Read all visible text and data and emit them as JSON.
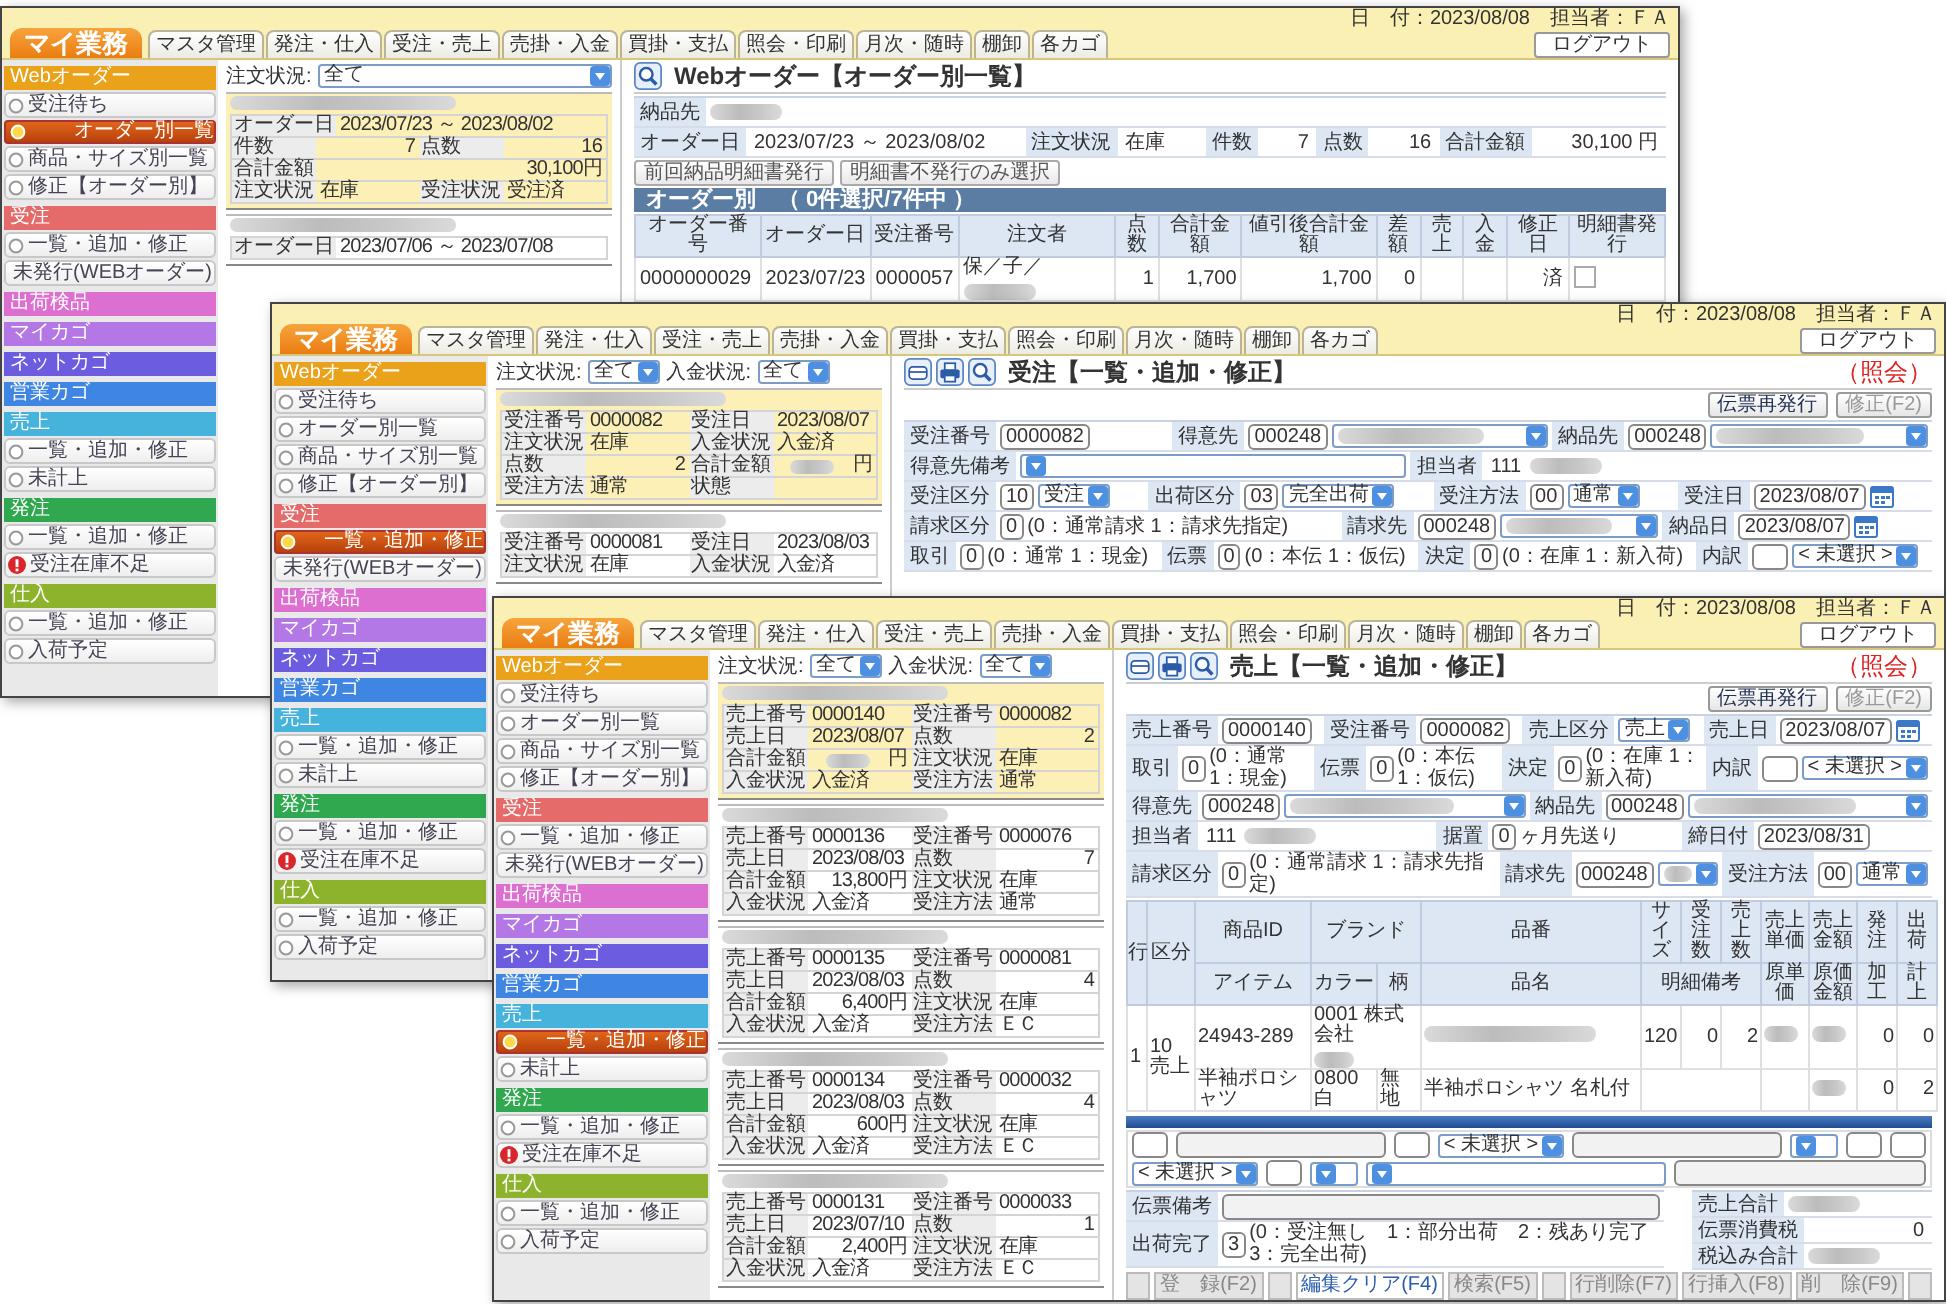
{
  "windows": [
    {
      "kind": "list_view",
      "header": {
        "brand": "マイ業務",
        "tabs": [
          "マスタ管理",
          "発注・仕入",
          "受注・売上",
          "売掛・入金",
          "買掛・支払",
          "照会・印刷",
          "月次・随時",
          "棚卸",
          "各カゴ"
        ],
        "date": "日　付：2023/08/08",
        "user": "担当者：ＦＡ",
        "logout": "ログアウト"
      },
      "sidebar": [
        {
          "title": "Webオーダー",
          "color": "#e9a21a",
          "items": [
            {
              "label": "受注待ち",
              "selected": false,
              "alert": false
            },
            {
              "label": "オーダー別一覧",
              "selected": true,
              "alert": false
            },
            {
              "label": "商品・サイズ別一覧",
              "selected": false,
              "alert": false
            },
            {
              "label": "修正【オーダー別】",
              "selected": false,
              "alert": false
            }
          ]
        },
        {
          "title": "受注",
          "color": "#e56b6b",
          "items": [
            {
              "label": "一覧・追加・修正",
              "selected": false,
              "alert": false
            },
            {
              "label": "未発行(WEBオーダー)",
              "selected": false,
              "alert": false
            }
          ]
        },
        {
          "title": "出荷検品",
          "color": "#dc6fcf"
        },
        {
          "title": "マイカゴ",
          "color": "#b478e6"
        },
        {
          "title": "ネットカゴ",
          "color": "#6b5ce0"
        },
        {
          "title": "営業カゴ",
          "color": "#3f86e3"
        },
        {
          "title": "売上",
          "color": "#46b3dc",
          "items": [
            {
              "label": "一覧・追加・修正",
              "selected": false,
              "alert": false
            },
            {
              "label": "未計上",
              "selected": false,
              "alert": false
            }
          ]
        },
        {
          "title": "発注",
          "color": "#2fa84f",
          "items": [
            {
              "label": "一覧・追加・修正",
              "selected": false,
              "alert": false
            },
            {
              "label": "受注在庫不足",
              "selected": false,
              "alert": true
            }
          ]
        },
        {
          "title": "仕入",
          "color": "#8db32c",
          "items": [
            {
              "label": "一覧・追加・修正",
              "selected": false,
              "alert": false
            },
            {
              "label": "入荷予定",
              "selected": false,
              "alert": false
            }
          ]
        }
      ],
      "filters": [
        {
          "label": "注文状況:",
          "value": "全て"
        }
      ],
      "cards": [
        {
          "selected": true,
          "rows": [
            [
              {
                "label": "オーダー日",
                "kind": "text",
                "value": "2023/07/23 ～ 2023/08/02"
              }
            ],
            [
              {
                "label": "件数",
                "kind": "num",
                "value": "7"
              },
              {
                "label": "点数",
                "kind": "num",
                "value": "16"
              }
            ],
            [
              {
                "label": "合計金額",
                "kind": "num",
                "value": "30,100円"
              }
            ],
            [
              {
                "label": "注文状況",
                "kind": "text",
                "value": "在庫"
              },
              {
                "label": "受注状況",
                "kind": "text",
                "value": "受注済"
              }
            ]
          ]
        },
        {
          "selected": false,
          "rows": [
            [
              {
                "label": "オーダー日",
                "kind": "text",
                "value": "2023/07/06 ～ 2023/07/08"
              }
            ]
          ]
        }
      ],
      "main": {
        "title": "Webオーダー【オーダー別一覧】",
        "form_rows": [
          [
            {
              "label": "納品先",
              "controls": [
                {
                  "kind": "blur"
                }
              ]
            }
          ],
          [
            {
              "label": "オーダー日",
              "controls": [
                {
                  "kind": "text",
                  "value": "2023/07/23 ～ 2023/08/02"
                }
              ]
            },
            {
              "label": "注文状況",
              "controls": [
                {
                  "kind": "text",
                  "value": "在庫"
                }
              ]
            },
            {
              "label": "件数",
              "controls": [
                {
                  "kind": "num",
                  "value": "7"
                }
              ]
            },
            {
              "label": "点数",
              "controls": [
                {
                  "kind": "num",
                  "value": "16"
                }
              ]
            },
            {
              "label": "合計金額",
              "controls": [
                {
                  "kind": "num",
                  "value": "30,100 円"
                }
              ]
            }
          ]
        ],
        "buttons": [
          "前回納品明細書発行",
          "明細書不発行のみ選択"
        ],
        "table": {
          "caption": "オーダー別　（ 0件選択/7件中 ）",
          "columns": [
            "オーダー番号",
            "オーダー日",
            "受注番号",
            "注文者",
            "点数",
            "合計金額",
            "値引後合計金額",
            "差額",
            "売上",
            "入金",
            "修正日",
            "明細書発行"
          ],
          "rows": [
            {
              "checked": false,
              "cells": [
                {
                  "kind": "text",
                  "text": "0000000029"
                },
                {
                  "kind": "text",
                  "text": "2023/07/23"
                },
                {
                  "kind": "text",
                  "text": "0000057"
                },
                {
                  "kind": "textblur",
                  "text": "保／子／"
                },
                {
                  "kind": "num",
                  "text": "1"
                },
                {
                  "kind": "num",
                  "text": "1,700"
                },
                {
                  "kind": "num",
                  "text": "1,700"
                },
                {
                  "kind": "num",
                  "text": "0"
                },
                {
                  "kind": "empty"
                },
                {
                  "kind": "empty"
                },
                {
                  "kind": "num",
                  "text": "済"
                }
              ]
            }
          ]
        }
      }
    },
    {
      "kind": "entry_form",
      "header": {
        "brand": "マイ業務",
        "tabs": [
          "マスタ管理",
          "発注・仕入",
          "受注・売上",
          "売掛・入金",
          "買掛・支払",
          "照会・印刷",
          "月次・随時",
          "棚卸",
          "各カゴ"
        ],
        "date": "日　付：2023/08/08",
        "user": "担当者：ＦＡ",
        "logout": "ログアウト"
      },
      "sidebar": [
        {
          "title": "Webオーダー",
          "color": "#e9a21a",
          "items": [
            {
              "label": "受注待ち",
              "selected": false,
              "alert": false
            },
            {
              "label": "オーダー別一覧",
              "selected": false,
              "alert": false
            },
            {
              "label": "商品・サイズ別一覧",
              "selected": false,
              "alert": false
            },
            {
              "label": "修正【オーダー別】",
              "selected": false,
              "alert": false
            }
          ]
        },
        {
          "title": "受注",
          "color": "#e56b6b",
          "items": [
            {
              "label": "一覧・追加・修正",
              "selected": true,
              "alert": false
            },
            {
              "label": "未発行(WEBオーダー)",
              "selected": false,
              "alert": false
            }
          ]
        },
        {
          "title": "出荷検品",
          "color": "#dc6fcf"
        },
        {
          "title": "マイカゴ",
          "color": "#b478e6"
        },
        {
          "title": "ネットカゴ",
          "color": "#6b5ce0"
        },
        {
          "title": "営業カゴ",
          "color": "#3f86e3"
        },
        {
          "title": "売上",
          "color": "#46b3dc",
          "items": [
            {
              "label": "一覧・追加・修正",
              "selected": false,
              "alert": false
            },
            {
              "label": "未計上",
              "selected": false,
              "alert": false
            }
          ]
        },
        {
          "title": "発注",
          "color": "#2fa84f",
          "items": [
            {
              "label": "一覧・追加・修正",
              "selected": false,
              "alert": false
            },
            {
              "label": "受注在庫不足",
              "selected": false,
              "alert": true
            }
          ]
        },
        {
          "title": "仕入",
          "color": "#8db32c",
          "items": [
            {
              "label": "一覧・追加・修正",
              "selected": false,
              "alert": false
            },
            {
              "label": "入荷予定",
              "selected": false,
              "alert": false
            }
          ]
        }
      ],
      "filters": [
        {
          "label": "注文状況:",
          "value": "全て"
        },
        {
          "label": "入金状況:",
          "value": "全て"
        }
      ],
      "cards": [
        {
          "selected": true,
          "rows": [
            [
              {
                "label": "受注番号",
                "kind": "text",
                "value": "0000082"
              },
              {
                "label": "受注日",
                "kind": "text",
                "value": "2023/08/07"
              }
            ],
            [
              {
                "label": "注文状況",
                "kind": "text",
                "value": "在庫"
              },
              {
                "label": "入金状況",
                "kind": "text",
                "value": "入金済"
              }
            ],
            [
              {
                "label": "点数",
                "kind": "num",
                "value": "2"
              },
              {
                "label": "合計金額",
                "kind": "blurnum",
                "value": "円"
              }
            ],
            [
              {
                "label": "受注方法",
                "kind": "text",
                "value": "通常"
              },
              {
                "label": "状態",
                "kind": "empty"
              }
            ]
          ]
        },
        {
          "selected": false,
          "rows": [
            [
              {
                "label": "受注番号",
                "kind": "text",
                "value": "0000081"
              },
              {
                "label": "受注日",
                "kind": "text",
                "value": "2023/08/03"
              }
            ],
            [
              {
                "label": "注文状況",
                "kind": "text",
                "value": "在庫"
              },
              {
                "label": "入金状況",
                "kind": "text",
                "value": "入金済"
              }
            ]
          ]
        }
      ],
      "main": {
        "title": "受注【一覧・追加・修正】",
        "mode": "（照会）",
        "actions": [
          {
            "label": "伝票再発行",
            "disabled": false
          },
          {
            "label": "修正(F2)",
            "disabled": true
          }
        ],
        "form_rows": [
          [
            {
              "label": "受注番号",
              "controls": [
                {
                  "kind": "code",
                  "value": "0000082"
                }
              ]
            },
            {
              "label": "得意先",
              "controls": [
                {
                  "kind": "code",
                  "value": "000248"
                },
                {
                  "kind": "blurselect"
                }
              ]
            },
            {
              "label": "納品先",
              "controls": [
                {
                  "kind": "code",
                  "value": "000248"
                },
                {
                  "kind": "blurselect"
                }
              ]
            }
          ],
          [
            {
              "label": "得意先備考",
              "controls": [
                {
                  "kind": "wideselect"
                }
              ]
            },
            {
              "label": "担当者",
              "controls": [
                {
                  "kind": "text",
                  "value": "111"
                },
                {
                  "kind": "blur"
                }
              ]
            }
          ],
          [
            {
              "label": "受注区分",
              "controls": [
                {
                  "kind": "code",
                  "value": "10"
                },
                {
                  "kind": "select",
                  "value": "受注"
                }
              ]
            },
            {
              "label": "出荷区分",
              "controls": [
                {
                  "kind": "code",
                  "value": "03"
                },
                {
                  "kind": "select",
                  "value": "完全出荷"
                }
              ]
            },
            {
              "label": "受注方法",
              "controls": [
                {
                  "kind": "code",
                  "value": "00"
                },
                {
                  "kind": "select",
                  "value": "通常"
                }
              ]
            },
            {
              "label": "受注日",
              "controls": [
                {
                  "kind": "date",
                  "value": "2023/08/07"
                }
              ]
            }
          ],
          [
            {
              "label": "請求区分",
              "controls": [
                {
                  "kind": "code",
                  "value": "0"
                },
                {
                  "kind": "note",
                  "value": "(0：通常請求 1：請求先指定)"
                }
              ]
            },
            {
              "label": "請求先",
              "controls": [
                {
                  "kind": "code",
                  "value": "000248"
                },
                {
                  "kind": "blurselect"
                }
              ]
            },
            {
              "label": "納品日",
              "controls": [
                {
                  "kind": "date",
                  "value": "2023/08/07"
                }
              ]
            }
          ],
          [
            {
              "label": "取引",
              "controls": [
                {
                  "kind": "code",
                  "value": "0"
                },
                {
                  "kind": "note",
                  "value": "(0：通常 1：現金)"
                }
              ]
            },
            {
              "label": "伝票",
              "controls": [
                {
                  "kind": "code",
                  "value": "0"
                },
                {
                  "kind": "note",
                  "value": "(0：本伝 1：仮伝)"
                }
              ]
            },
            {
              "label": "決定",
              "controls": [
                {
                  "kind": "code",
                  "value": "0"
                },
                {
                  "kind": "note",
                  "value": "(0：在庫 1：新入荷)"
                }
              ]
            },
            {
              "label": "内訳",
              "controls": [
                {
                  "kind": "box"
                },
                {
                  "kind": "select",
                  "value": "< 未選択 >"
                }
              ]
            }
          ]
        ]
      }
    },
    {
      "kind": "entry_form",
      "header": {
        "brand": "マイ業務",
        "tabs": [
          "マスタ管理",
          "発注・仕入",
          "受注・売上",
          "売掛・入金",
          "買掛・支払",
          "照会・印刷",
          "月次・随時",
          "棚卸",
          "各カゴ"
        ],
        "date": "日　付：2023/08/08",
        "user": "担当者：ＦＡ",
        "logout": "ログアウト"
      },
      "sidebar": [
        {
          "title": "Webオーダー",
          "color": "#e9a21a",
          "items": [
            {
              "label": "受注待ち",
              "selected": false,
              "alert": false
            },
            {
              "label": "オーダー別一覧",
              "selected": false,
              "alert": false
            },
            {
              "label": "商品・サイズ別一覧",
              "selected": false,
              "alert": false
            },
            {
              "label": "修正【オーダー別】",
              "selected": false,
              "alert": false
            }
          ]
        },
        {
          "title": "受注",
          "color": "#e56b6b",
          "items": [
            {
              "label": "一覧・追加・修正",
              "selected": false,
              "alert": false
            },
            {
              "label": "未発行(WEBオーダー)",
              "selected": false,
              "alert": false
            }
          ]
        },
        {
          "title": "出荷検品",
          "color": "#dc6fcf"
        },
        {
          "title": "マイカゴ",
          "color": "#b478e6"
        },
        {
          "title": "ネットカゴ",
          "color": "#6b5ce0"
        },
        {
          "title": "営業カゴ",
          "color": "#3f86e3"
        },
        {
          "title": "売上",
          "color": "#46b3dc",
          "items": [
            {
              "label": "一覧・追加・修正",
              "selected": true,
              "alert": false
            },
            {
              "label": "未計上",
              "selected": false,
              "alert": false
            }
          ]
        },
        {
          "title": "発注",
          "color": "#2fa84f",
          "items": [
            {
              "label": "一覧・追加・修正",
              "selected": false,
              "alert": false
            },
            {
              "label": "受注在庫不足",
              "selected": false,
              "alert": true
            }
          ]
        },
        {
          "title": "仕入",
          "color": "#8db32c",
          "items": [
            {
              "label": "一覧・追加・修正",
              "selected": false,
              "alert": false
            },
            {
              "label": "入荷予定",
              "selected": false,
              "alert": false
            }
          ]
        }
      ],
      "filters": [
        {
          "label": "注文状況:",
          "value": "全て"
        },
        {
          "label": "入金状況:",
          "value": "全て"
        }
      ],
      "cards": [
        {
          "selected": true,
          "rows": [
            [
              {
                "label": "売上番号",
                "kind": "text",
                "value": "0000140"
              },
              {
                "label": "受注番号",
                "kind": "text",
                "value": "0000082"
              }
            ],
            [
              {
                "label": "売上日",
                "kind": "text",
                "value": "2023/08/07"
              },
              {
                "label": "点数",
                "kind": "num",
                "value": "2"
              }
            ],
            [
              {
                "label": "合計金額",
                "kind": "blurnum",
                "value": "円"
              },
              {
                "label": "注文状況",
                "kind": "text",
                "value": "在庫"
              }
            ],
            [
              {
                "label": "入金状況",
                "kind": "text",
                "value": "入金済"
              },
              {
                "label": "受注方法",
                "kind": "text",
                "value": "通常"
              }
            ]
          ]
        },
        {
          "selected": false,
          "rows": [
            [
              {
                "label": "売上番号",
                "kind": "text",
                "value": "0000136"
              },
              {
                "label": "受注番号",
                "kind": "text",
                "value": "0000076"
              }
            ],
            [
              {
                "label": "売上日",
                "kind": "text",
                "value": "2023/08/03"
              },
              {
                "label": "点数",
                "kind": "num",
                "value": "7"
              }
            ],
            [
              {
                "label": "合計金額",
                "kind": "num",
                "value": "13,800円"
              },
              {
                "label": "注文状況",
                "kind": "text",
                "value": "在庫"
              }
            ],
            [
              {
                "label": "入金状況",
                "kind": "text",
                "value": "入金済"
              },
              {
                "label": "受注方法",
                "kind": "text",
                "value": "通常"
              }
            ]
          ]
        },
        {
          "selected": false,
          "rows": [
            [
              {
                "label": "売上番号",
                "kind": "text",
                "value": "0000135"
              },
              {
                "label": "受注番号",
                "kind": "text",
                "value": "0000081"
              }
            ],
            [
              {
                "label": "売上日",
                "kind": "text",
                "value": "2023/08/03"
              },
              {
                "label": "点数",
                "kind": "num",
                "value": "4"
              }
            ],
            [
              {
                "label": "合計金額",
                "kind": "num",
                "value": "6,400円"
              },
              {
                "label": "注文状況",
                "kind": "text",
                "value": "在庫"
              }
            ],
            [
              {
                "label": "入金状況",
                "kind": "text",
                "value": "入金済"
              },
              {
                "label": "受注方法",
                "kind": "text",
                "value": "ＥＣ"
              }
            ]
          ]
        },
        {
          "selected": false,
          "rows": [
            [
              {
                "label": "売上番号",
                "kind": "text",
                "value": "0000134"
              },
              {
                "label": "受注番号",
                "kind": "text",
                "value": "0000032"
              }
            ],
            [
              {
                "label": "売上日",
                "kind": "text",
                "value": "2023/08/03"
              },
              {
                "label": "点数",
                "kind": "num",
                "value": "4"
              }
            ],
            [
              {
                "label": "合計金額",
                "kind": "num",
                "value": "600円"
              },
              {
                "label": "注文状況",
                "kind": "text",
                "value": "在庫"
              }
            ],
            [
              {
                "label": "入金状況",
                "kind": "text",
                "value": "入金済"
              },
              {
                "label": "受注方法",
                "kind": "text",
                "value": "ＥＣ"
              }
            ]
          ]
        },
        {
          "selected": false,
          "rows": [
            [
              {
                "label": "売上番号",
                "kind": "text",
                "value": "0000131"
              },
              {
                "label": "受注番号",
                "kind": "text",
                "value": "0000033"
              }
            ],
            [
              {
                "label": "売上日",
                "kind": "text",
                "value": "2023/07/10"
              },
              {
                "label": "点数",
                "kind": "num",
                "value": "1"
              }
            ],
            [
              {
                "label": "合計金額",
                "kind": "num",
                "value": "2,400円"
              },
              {
                "label": "注文状況",
                "kind": "text",
                "value": "在庫"
              }
            ],
            [
              {
                "label": "入金状況",
                "kind": "text",
                "value": "入金済"
              },
              {
                "label": "受注方法",
                "kind": "text",
                "value": "ＥＣ"
              }
            ]
          ]
        }
      ],
      "main": {
        "title": "売上【一覧・追加・修正】",
        "mode": "（照会）",
        "actions": [
          {
            "label": "伝票再発行",
            "disabled": false
          },
          {
            "label": "修正(F2)",
            "disabled": true
          }
        ],
        "form_rows": [
          [
            {
              "label": "売上番号",
              "controls": [
                {
                  "kind": "code",
                  "value": "0000140"
                }
              ]
            },
            {
              "label": "受注番号",
              "controls": [
                {
                  "kind": "code",
                  "value": "0000082"
                }
              ]
            },
            {
              "label": "売上区分",
              "controls": [
                {
                  "kind": "select",
                  "value": "売上"
                }
              ]
            },
            {
              "label": "売上日",
              "controls": [
                {
                  "kind": "date",
                  "value": "2023/08/07"
                }
              ]
            }
          ],
          [
            {
              "label": "取引",
              "controls": [
                {
                  "kind": "code",
                  "value": "0"
                },
                {
                  "kind": "note",
                  "value": "(0：通常 1：現金)"
                }
              ]
            },
            {
              "label": "伝票",
              "controls": [
                {
                  "kind": "code",
                  "value": "0"
                },
                {
                  "kind": "note",
                  "value": "(0：本伝 1：仮伝)"
                }
              ]
            },
            {
              "label": "決定",
              "controls": [
                {
                  "kind": "code",
                  "value": "0"
                },
                {
                  "kind": "note",
                  "value": "(0：在庫 1：新入荷)"
                }
              ]
            },
            {
              "label": "内訳",
              "controls": [
                {
                  "kind": "box"
                },
                {
                  "kind": "select",
                  "value": "< 未選択 >"
                }
              ]
            }
          ],
          [
            {
              "label": "得意先",
              "controls": [
                {
                  "kind": "code",
                  "value": "000248"
                },
                {
                  "kind": "blurselect"
                }
              ]
            },
            {
              "label": "納品先",
              "controls": [
                {
                  "kind": "code",
                  "value": "000248"
                },
                {
                  "kind": "blurselect"
                }
              ]
            }
          ],
          [
            {
              "label": "担当者",
              "controls": [
                {
                  "kind": "text",
                  "value": "111"
                },
                {
                  "kind": "blur"
                }
              ]
            },
            {
              "label": "据置",
              "controls": [
                {
                  "kind": "code",
                  "value": "0"
                },
                {
                  "kind": "note",
                  "value": "ヶ月先送り"
                }
              ]
            },
            {
              "label": "締日付",
              "controls": [
                {
                  "kind": "code",
                  "value": "2023/08/31"
                }
              ]
            }
          ],
          [
            {
              "label": "請求区分",
              "controls": [
                {
                  "kind": "code",
                  "value": "0"
                },
                {
                  "kind": "note",
                  "value": "(0：通常請求 1：請求先指定)"
                }
              ]
            },
            {
              "label": "請求先",
              "controls": [
                {
                  "kind": "code",
                  "value": "000248"
                },
                {
                  "kind": "blurselect"
                }
              ]
            },
            {
              "label": "受注方法",
              "controls": [
                {
                  "kind": "code",
                  "value": "00"
                },
                {
                  "kind": "select",
                  "value": "通常"
                }
              ]
            }
          ]
        ],
        "detail": {
          "head": [
            {
              "top": [
                "行"
              ]
            },
            {
              "top": [
                "区分"
              ]
            },
            {
              "top": [
                "商品ID"
              ],
              "bottom": [
                "アイテム"
              ]
            },
            {
              "top": [
                "ブランド"
              ],
              "bottom": [
                "カラー",
                "柄"
              ]
            },
            {
              "top": [
                "品番"
              ],
              "bottom": [
                "品名"
              ]
            },
            {
              "top": [
                "サイズ",
                "受注数",
                "売上数"
              ],
              "bottom": [
                "明細備考"
              ]
            },
            {
              "top": [
                "売上単価"
              ],
              "bottom": [
                "原単価"
              ]
            },
            {
              "top": [
                "売上金額"
              ],
              "bottom": [
                "原価金額"
              ]
            },
            {
              "top": [
                "発注"
              ],
              "bottom": [
                "加工"
              ]
            },
            {
              "top": [
                "出荷"
              ],
              "bottom": [
                "計上"
              ]
            }
          ],
          "items": [
            [
              {
                "top": [
                  {
                    "kind": "text",
                    "text": "1"
                  }
                ]
              },
              {
                "top": [
                  {
                    "kind": "text",
                    "text": "10 売上"
                  }
                ]
              },
              {
                "top": [
                  {
                    "kind": "text",
                    "text": "24943-289"
                  }
                ],
                "bottom": [
                  {
                    "kind": "text",
                    "text": "半袖ポロシャツ"
                  }
                ]
              },
              {
                "top": [
                  {
                    "kind": "textblur",
                    "text": "0001 株式会社"
                  }
                ],
                "bottom": [
                  {
                    "kind": "text",
                    "text": "0800 白"
                  },
                  {
                    "kind": "text",
                    "text": "無地"
                  }
                ]
              },
              {
                "top": [
                  {
                    "kind": "blur"
                  }
                ],
                "bottom": [
                  {
                    "kind": "text",
                    "text": "半袖ポロシャツ 名札付"
                  }
                ]
              },
              {
                "top": [
                  {
                    "kind": "text",
                    "text": "120"
                  },
                  {
                    "kind": "num",
                    "text": "0"
                  },
                  {
                    "kind": "num",
                    "text": "2"
                  }
                ],
                "bottom": [
                  {
                    "kind": "empty"
                  }
                ]
              },
              {
                "top": [
                  {
                    "kind": "blur"
                  }
                ],
                "bottom": [
                  {
                    "kind": "empty"
                  }
                ]
              },
              {
                "top": [
                  {
                    "kind": "blur"
                  }
                ],
                "bottom": [
                  {
                    "kind": "blur"
                  }
                ]
              },
              {
                "top": [
                  {
                    "kind": "num",
                    "text": "0"
                  }
                ],
                "bottom": [
                  {
                    "kind": "num",
                    "text": "0"
                  }
                ]
              },
              {
                "top": [
                  {
                    "kind": "num",
                    "text": "0"
                  }
                ],
                "bottom": [
                  {
                    "kind": "num",
                    "text": "2"
                  }
                ]
              }
            ]
          ]
        },
        "edit_lines": [
          [
            {
              "kind": "box"
            },
            {
              "kind": "field"
            },
            {
              "kind": "box"
            },
            {
              "kind": "select",
              "value": "< 未選択 >"
            },
            {
              "kind": "field"
            },
            {
              "kind": "select"
            },
            {
              "kind": "box"
            },
            {
              "kind": "box"
            }
          ],
          [
            {
              "kind": "select",
              "value": "< 未選択 >"
            },
            {
              "kind": "box"
            },
            {
              "kind": "select"
            },
            {
              "kind": "wideselect"
            },
            {
              "kind": "field"
            }
          ]
        ],
        "memo_rows": [
          [
            {
              "label": "伝票備考",
              "controls": [
                {
                  "kind": "field"
                }
              ]
            }
          ],
          [
            {
              "label": "出荷完了",
              "controls": [
                {
                  "kind": "code",
                  "value": "3"
                },
                {
                  "kind": "note",
                  "value": "(0：受注無し　1：部分出荷　2：残あり完了　3：完全出荷)"
                }
              ]
            }
          ]
        ],
        "totals": [
          [
            {
              "label": "売上合計",
              "controls": [
                {
                  "kind": "blur"
                }
              ]
            }
          ],
          [
            {
              "label": "伝票消費税",
              "controls": [
                {
                  "kind": "num",
                  "value": "0"
                }
              ]
            }
          ],
          [
            {
              "label": "税込み合計",
              "controls": [
                {
                  "kind": "blur"
                }
              ]
            }
          ]
        ],
        "fkeys": [
          {
            "kind": "blank"
          },
          {
            "kind": "key",
            "label": "登　録(F2)",
            "disabled": true
          },
          {
            "kind": "blank"
          },
          {
            "kind": "key",
            "label": "編集クリア(F4)",
            "disabled": false
          },
          {
            "kind": "key",
            "label": "検索(F5)",
            "disabled": true
          },
          {
            "kind": "blank"
          },
          {
            "kind": "key",
            "label": "行削除(F7)",
            "disabled": true
          },
          {
            "kind": "key",
            "label": "行挿入(F8)",
            "disabled": true
          },
          {
            "kind": "key",
            "label": "削　除(F9)",
            "disabled": true
          },
          {
            "kind": "blank"
          }
        ]
      }
    }
  ]
}
